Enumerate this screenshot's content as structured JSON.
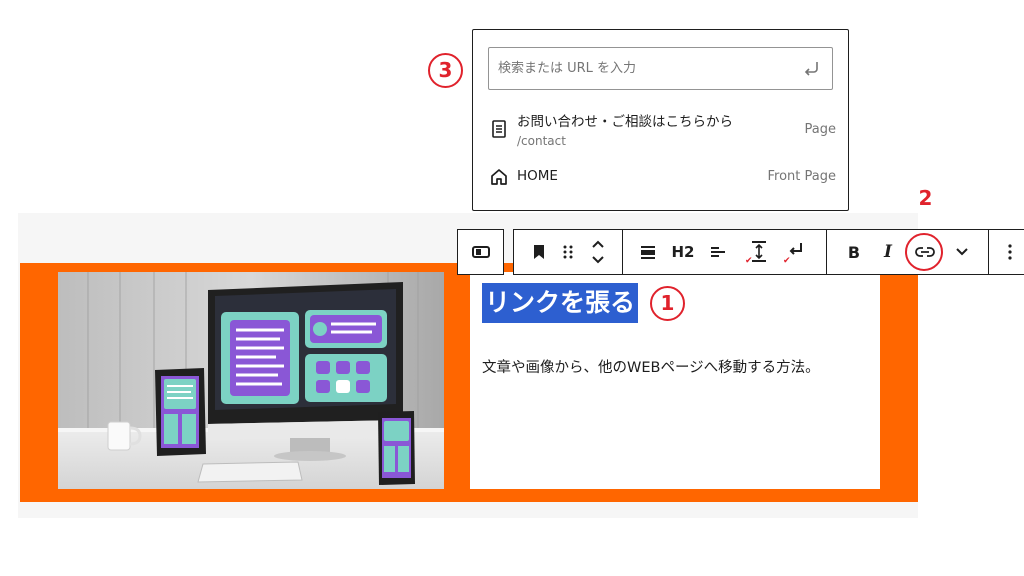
{
  "link_popover": {
    "search_placeholder": "検索または URL を入力",
    "suggestions": [
      {
        "title": "お問い合わせ・ご相談はこちらから",
        "url": "/contact",
        "type": "Page",
        "icon": "page-icon"
      },
      {
        "title": "HOME",
        "url": "",
        "type": "Front Page",
        "icon": "home-icon"
      }
    ]
  },
  "toolbar": {
    "heading_level_label": "H2",
    "bold_label": "B",
    "italic_label": "I",
    "icons": [
      "block-type-icon",
      "bookmark-icon",
      "drag-handle-icon",
      "move-up-down-icon",
      "align-icon",
      "text-align-icon",
      "line-height-icon",
      "line-break-icon",
      "link-icon",
      "chevron-down-icon",
      "more-options-icon"
    ]
  },
  "content": {
    "heading": "リンクを張る",
    "paragraph": "文章や画像から、他のWEBページへ移動する方法。"
  },
  "callouts": {
    "one": "1",
    "two": "2",
    "three": "3"
  },
  "colors": {
    "accent": "#ff6600",
    "highlight": "#2d5fd0",
    "callout": "#e0222c"
  }
}
